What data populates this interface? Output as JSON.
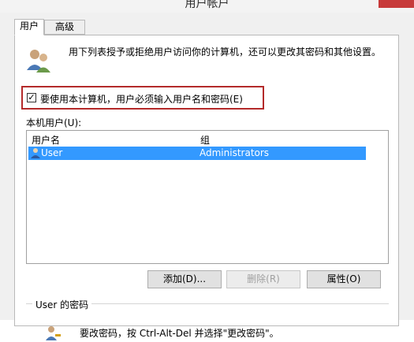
{
  "window": {
    "title": "用户帐户"
  },
  "tabs": [
    {
      "label": "用户",
      "active": true
    },
    {
      "label": "高级",
      "active": false
    }
  ],
  "intro_text": "用下列表授予或拒绝用户访问你的计算机，还可以更改其密码和其他设置。",
  "require_login": {
    "label": "要使用本计算机，用户必须输入用户名和密码(E)",
    "checked": true,
    "mark": "✓"
  },
  "users_section": {
    "label": "本机用户(U):",
    "columns": [
      "用户名",
      "组"
    ],
    "rows": [
      {
        "name": "User",
        "group": "Administrators",
        "selected": true
      }
    ]
  },
  "buttons": {
    "add": "添加(D)...",
    "remove": "删除(R)",
    "properties": "属性(O)"
  },
  "password_section": {
    "title": "User 的密码",
    "text": "要改密码，按 Ctrl-Alt-Del 并选择\"更改密码\"。"
  },
  "colors": {
    "selection": "#3399ff",
    "highlight_border": "#b42a2a",
    "close_button": "#c73a3a"
  },
  "icons": [
    "users-icon",
    "user-row-icon",
    "password-key-icon"
  ]
}
